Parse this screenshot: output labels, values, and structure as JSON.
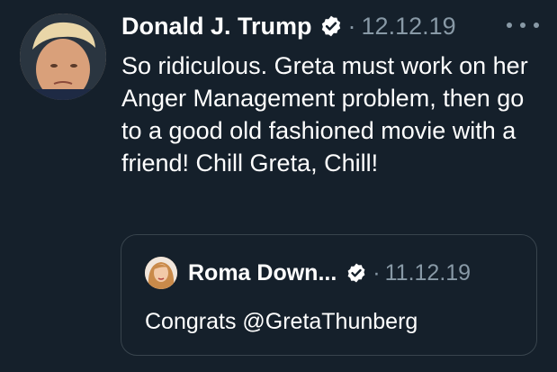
{
  "tweet": {
    "author_name": "Donald J. Trump",
    "separator": "·",
    "date": "12.12.19",
    "text": "So ridiculous. Greta must work on her Anger Management problem, then go to a good old fashioned movie with a friend! Chill Greta, Chill!",
    "verified_icon": "verified-badge-icon",
    "more_icon": "more-options-icon"
  },
  "quoted_tweet": {
    "author_name": "Roma Down...",
    "separator": "·",
    "date": "11.12.19",
    "text": "Congrats @GretaThunberg",
    "verified_icon": "verified-badge-icon"
  },
  "colors": {
    "background": "#15202b",
    "primary_text": "#ffffff",
    "secondary_text": "#8899a6",
    "border": "#38444d"
  }
}
